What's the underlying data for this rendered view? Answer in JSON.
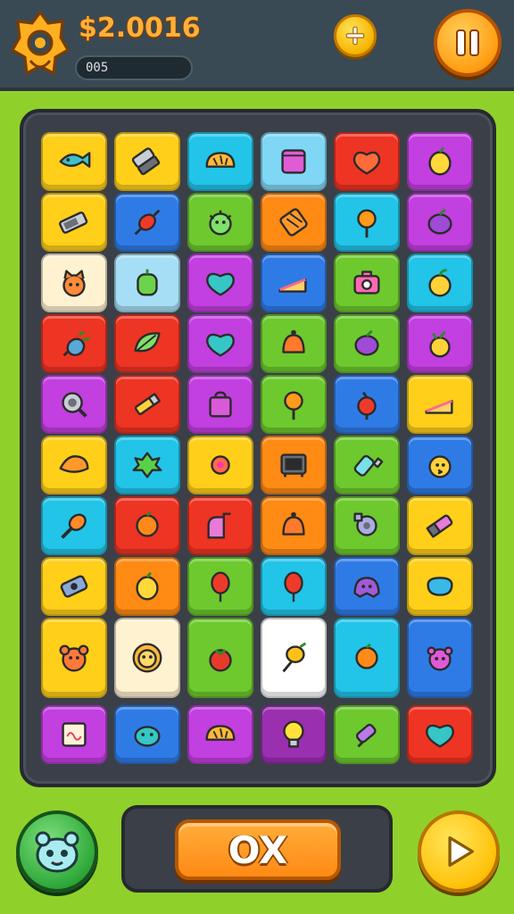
{
  "header": {
    "score": "$2.0016",
    "progress_text": "005",
    "logo_icon": "gem-badge-icon",
    "add_icon": "plus-icon",
    "pause_icon": "pause-icon"
  },
  "footer": {
    "action_label": "OX",
    "hero_icon": "creature-avatar-icon",
    "play_icon": "play-icon"
  },
  "board": {
    "rows": [
      [
        {
          "icon": "fish-icon",
          "color": "#ffcf1a"
        },
        {
          "icon": "phone-icon",
          "color": "#ffcf1a"
        },
        {
          "icon": "bread-icon",
          "color": "#22c4e8"
        },
        {
          "icon": "cube-icon",
          "color": "#7fd6f5"
        },
        {
          "icon": "heart-apple-icon",
          "color": "#ee3423"
        },
        {
          "icon": "lemon-icon",
          "color": "#c23fe0"
        }
      ],
      [
        {
          "icon": "battery-icon",
          "color": "#ffcf1a"
        },
        {
          "icon": "candy-icon",
          "color": "#2f7be6"
        },
        {
          "icon": "germ-icon",
          "color": "#6dc92e"
        },
        {
          "icon": "snack-icon",
          "color": "#ff8a14"
        },
        {
          "icon": "lollipop-icon",
          "color": "#22c4e8"
        },
        {
          "icon": "plum-icon",
          "color": "#c23fe0"
        }
      ],
      [
        {
          "icon": "cat-icon",
          "color": "#fff2d0"
        },
        {
          "icon": "pepper-icon",
          "color": "#a6dff5"
        },
        {
          "icon": "heart-icon",
          "color": "#c23fe0"
        },
        {
          "icon": "cake-slice-icon",
          "color": "#2f7be6"
        },
        {
          "icon": "camera-icon",
          "color": "#6dc92e"
        },
        {
          "icon": "apple-icon",
          "color": "#22c4e8"
        }
      ],
      [
        {
          "icon": "pineapple-icon",
          "color": "#ee3423"
        },
        {
          "icon": "leaf-icon",
          "color": "#ee3423"
        },
        {
          "icon": "heart-icon",
          "color": "#c23fe0"
        },
        {
          "icon": "bell-icon",
          "color": "#6dc92e"
        },
        {
          "icon": "plum-icon",
          "color": "#6dc92e"
        },
        {
          "icon": "berry-icon",
          "color": "#c23fe0"
        }
      ],
      [
        {
          "icon": "magnifier-icon",
          "color": "#c23fe0"
        },
        {
          "icon": "pencil-icon",
          "color": "#ee3423"
        },
        {
          "icon": "bag-icon",
          "color": "#c23fe0"
        },
        {
          "icon": "lollipop-icon",
          "color": "#6dc92e"
        },
        {
          "icon": "cherry-icon",
          "color": "#2f7be6"
        },
        {
          "icon": "cake-slice-icon",
          "color": "#ffcf1a"
        }
      ],
      [
        {
          "icon": "croissant-icon",
          "color": "#ffcf1a"
        },
        {
          "icon": "clover-icon",
          "color": "#22c4e8"
        },
        {
          "icon": "flower-icon",
          "color": "#ffcf1a"
        },
        {
          "icon": "tv-icon",
          "color": "#ff8a14"
        },
        {
          "icon": "bottle-icon",
          "color": "#6dc92e"
        },
        {
          "icon": "chick-icon",
          "color": "#2f7be6"
        }
      ],
      [
        {
          "icon": "drumstick-icon",
          "color": "#22c4e8"
        },
        {
          "icon": "orange-icon",
          "color": "#ee3423"
        },
        {
          "icon": "mailbox-icon",
          "color": "#ee3423"
        },
        {
          "icon": "bell-icon",
          "color": "#ff8a14"
        },
        {
          "icon": "bolt-nut-icon",
          "color": "#6dc92e"
        },
        {
          "icon": "lipstick-icon",
          "color": "#ffcf1a"
        }
      ],
      [
        {
          "icon": "gadget-icon",
          "color": "#ffcf1a"
        },
        {
          "icon": "lemon-icon",
          "color": "#ff8a14"
        },
        {
          "icon": "balloon-icon",
          "color": "#6dc92e"
        },
        {
          "icon": "balloon-icon",
          "color": "#22c4e8"
        },
        {
          "icon": "monster-icon",
          "color": "#2f7be6"
        },
        {
          "icon": "gem-icon",
          "color": "#ffcf1a"
        }
      ],
      [
        {
          "icon": "bear-icon",
          "color": "#ffcf1a"
        },
        {
          "icon": "lion-icon",
          "color": "#fff2d0"
        },
        {
          "icon": "tomato-icon",
          "color": "#6dc92e"
        },
        {
          "icon": "popsicle-icon",
          "color": "#ffffff"
        },
        {
          "icon": "orange-icon",
          "color": "#22c4e8"
        },
        {
          "icon": "critter-icon",
          "color": "#2f7be6"
        }
      ],
      [
        {
          "icon": "note-icon",
          "color": "#c23fe0"
        },
        {
          "icon": "whale-icon",
          "color": "#2f7be6"
        },
        {
          "icon": "bread-icon",
          "color": "#c23fe0"
        },
        {
          "icon": "bulb-icon",
          "color": "#9a2fb0"
        },
        {
          "icon": "ice-cream-icon",
          "color": "#6dc92e"
        },
        {
          "icon": "heart-icon",
          "color": "#ee3423"
        }
      ]
    ]
  }
}
